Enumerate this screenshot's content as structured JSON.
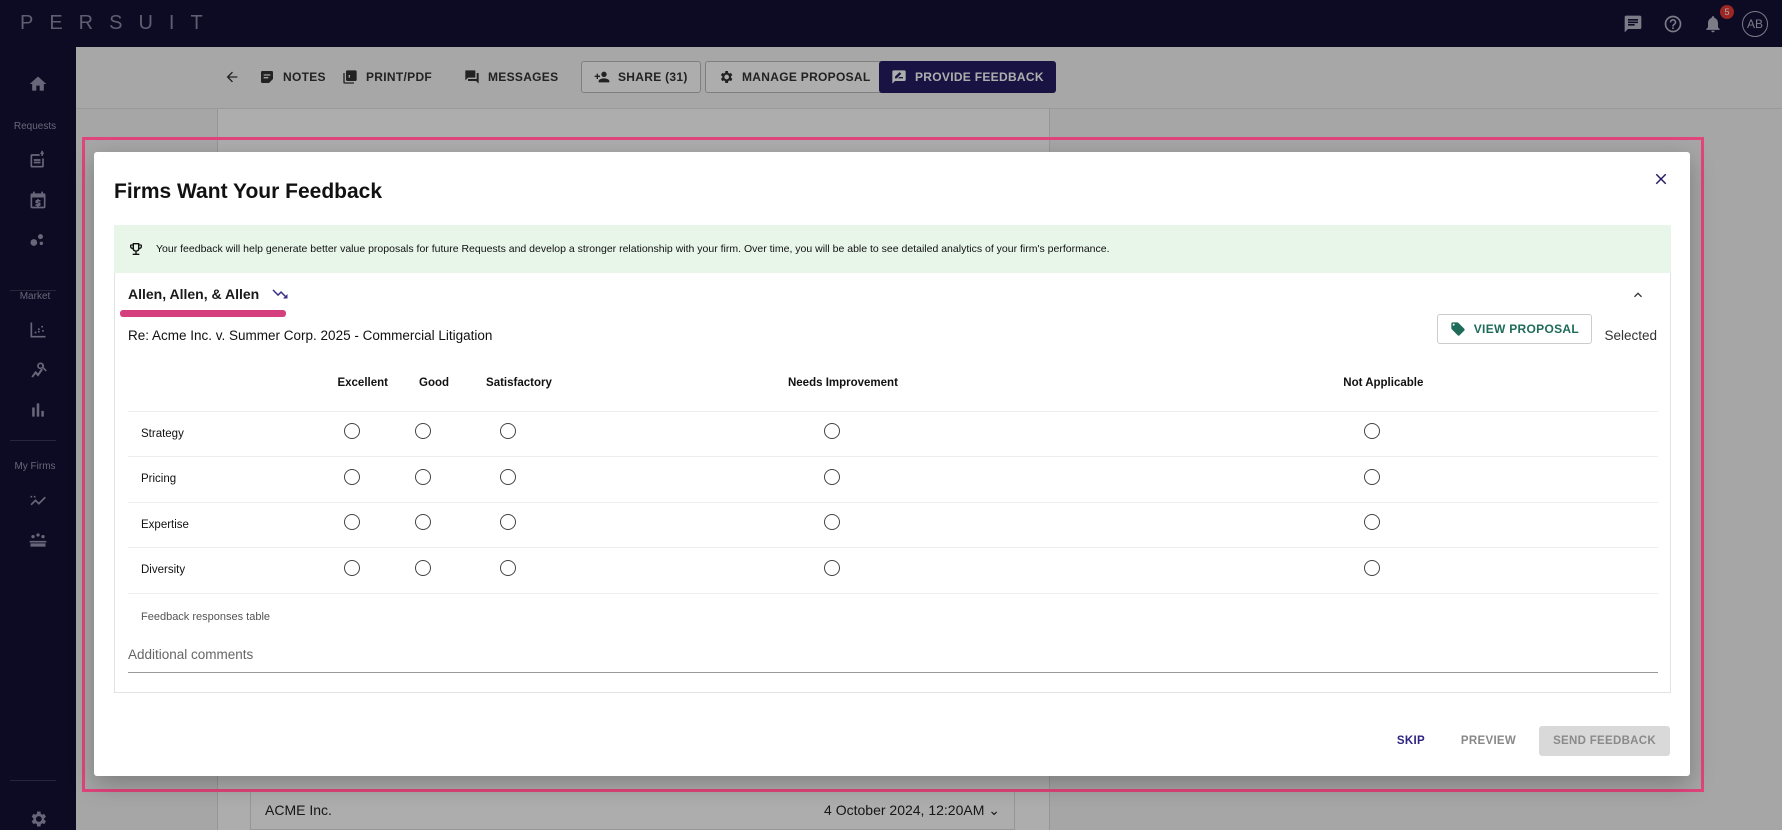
{
  "app": {
    "logo": "PERSUIT"
  },
  "topbar": {
    "notification_count": "5",
    "avatar_initials": "AB"
  },
  "sidebar": {
    "sections": {
      "requests": "Requests",
      "market": "Market",
      "my_firms": "My Firms"
    }
  },
  "toolbar": {
    "notes": "NOTES",
    "print": "PRINT/PDF",
    "messages": "MESSAGES",
    "share": "SHARE (31)",
    "manage": "MANAGE PROPOSAL",
    "feedback": "PROVIDE FEEDBACK"
  },
  "background_row": {
    "client": "ACME Inc.",
    "date": "4 October 2024, 12:20AM"
  },
  "dialog": {
    "title": "Firms Want Your Feedback",
    "banner": "Your feedback will help generate better value proposals for future Requests and develop a stronger relationship with your firm. Over time, you will be able to see detailed analytics of your firm's performance.",
    "firm_name": "Allen, Allen, & Allen",
    "request_title": "Re: Acme Inc. v. Summer Corp. 2025 - Commercial Litigation",
    "view_proposal": "VIEW PROPOSAL",
    "status": "Selected",
    "columns": [
      "Excellent",
      "Good",
      "Satisfactory",
      "Needs Improvement",
      "Not Applicable"
    ],
    "criteria": [
      "Strategy",
      "Pricing",
      "Expertise",
      "Diversity"
    ],
    "table_caption": "Feedback responses table",
    "comments_placeholder": "Additional comments",
    "actions": {
      "skip": "SKIP",
      "preview": "PREVIEW",
      "send": "SEND FEEDBACK"
    }
  }
}
